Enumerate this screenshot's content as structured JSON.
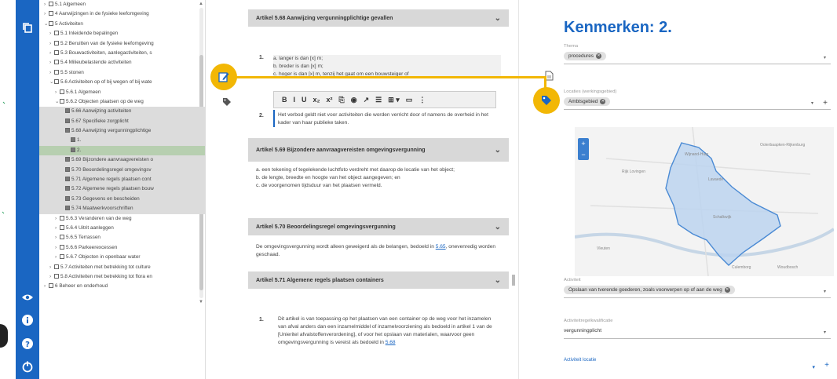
{
  "rail": {
    "icons": [
      "copy-icon",
      "eye-icon",
      "info-icon",
      "help-icon",
      "power-icon"
    ]
  },
  "tree": {
    "rows": [
      {
        "t": "5.1 Algemeen",
        "indent": 0,
        "style": "",
        "kind": "folder"
      },
      {
        "t": "4 Aanwijzingen in de fysieke leefomgeving",
        "indent": 0,
        "style": "",
        "kind": "folder"
      },
      {
        "t": "5 Activiteiten",
        "indent": 0,
        "style": "",
        "kind": "folder-open"
      },
      {
        "t": "5.1 Inleidende bepalingen",
        "indent": 1,
        "style": "",
        "kind": "folder"
      },
      {
        "t": "5.2 Beruitten van de fysieke leefomgeving",
        "indent": 1,
        "style": "",
        "kind": "folder"
      },
      {
        "t": "5.3 Bouwactiviteiten, aanlegactiviteiten, s",
        "indent": 1,
        "style": "",
        "kind": "folder"
      },
      {
        "t": "5.4 Milieubelastende activiteiten",
        "indent": 1,
        "style": "",
        "kind": "folder"
      },
      {
        "t": "5.5 stonen",
        "indent": 1,
        "style": "",
        "kind": "folder"
      },
      {
        "t": "5.6 Activiteiten op of bij wegen of bij wate",
        "indent": 1,
        "style": "",
        "kind": "folder-open"
      },
      {
        "t": "5.6.1 Algemeen",
        "indent": 2,
        "style": "",
        "kind": "folder"
      },
      {
        "t": "5.6.2 Objecten plaatsen op de weg",
        "indent": 2,
        "style": "",
        "kind": "folder-open"
      },
      {
        "t": "5.66 Aanwijzing activiteiten",
        "indent": 3,
        "style": "shade",
        "kind": "check"
      },
      {
        "t": "5.67 Specifieke zorgplicht",
        "indent": 3,
        "style": "shade",
        "kind": "check"
      },
      {
        "t": "5.68 Aanwijzing vergunningplichtige",
        "indent": 3,
        "style": "shade",
        "kind": "check"
      },
      {
        "t": "1.",
        "indent": 4,
        "style": "shade",
        "kind": "check"
      },
      {
        "t": "2.",
        "indent": 4,
        "style": "green",
        "kind": "check"
      },
      {
        "t": "5.69 Bijzondere aanvraagvereisten o",
        "indent": 3,
        "style": "shade",
        "kind": "check"
      },
      {
        "t": "5.70 Beoordelingsregel omgevingsv",
        "indent": 3,
        "style": "shade",
        "kind": "check"
      },
      {
        "t": "5.71 Algemene regels plaatsen cont",
        "indent": 3,
        "style": "shade",
        "kind": "check"
      },
      {
        "t": "5.72 Algemene regels plaatsen bouw",
        "indent": 3,
        "style": "shade",
        "kind": "check"
      },
      {
        "t": "5.73 Gegevens en bescheiden",
        "indent": 3,
        "style": "shade",
        "kind": "check"
      },
      {
        "t": "5.74 Maatwerkvoorschriften",
        "indent": 3,
        "style": "shade",
        "kind": "check"
      },
      {
        "t": "5.6.3 Veranderen van de weg",
        "indent": 2,
        "style": "",
        "kind": "folder"
      },
      {
        "t": "5.6.4 Uitrit aanleggen",
        "indent": 2,
        "style": "",
        "kind": "folder"
      },
      {
        "t": "5.6.5 Terrassen",
        "indent": 2,
        "style": "",
        "kind": "folder"
      },
      {
        "t": "5.6.6 Parkeerexcessen",
        "indent": 2,
        "style": "",
        "kind": "folder"
      },
      {
        "t": "5.6.7 Objecten in openbaar water",
        "indent": 2,
        "style": "",
        "kind": "folder"
      },
      {
        "t": "5.7 Activiteiten met betrekking tot culture",
        "indent": 1,
        "style": "",
        "kind": "folder"
      },
      {
        "t": "5.8 Activiteiten met betrekking tot flora en",
        "indent": 1,
        "style": "",
        "kind": "folder"
      },
      {
        "t": "6 Beheer en onderhoud",
        "indent": 0,
        "style": "",
        "kind": "folder"
      }
    ]
  },
  "doc": {
    "art568": {
      "title": "Artikel  5.68  Aanwijzing vergunningplichtige gevallen"
    },
    "art568_items": [
      "a.  langer is dan [x] m;",
      "b.  breder is dan [x] m;",
      "c.  hoger is dan [x] m, tenzij het gaat om een bouwsteiger of"
    ],
    "art568_num1": "1.",
    "art568_num2": "2.",
    "art568_p2": "Het verbod geldt niet voor activiteiten die worden verricht door of namens de overheid in het kader van haar publieke taken.",
    "toolbar": [
      "B",
      "I",
      "U",
      "x₂",
      "x²",
      "⎘",
      "◉",
      "↗",
      "☰",
      "⊞ ▾",
      "▭",
      "⋮"
    ],
    "art569": {
      "title": "Artikel  5.69  Bijzondere aanvraagvereisten omgevingsvergunning"
    },
    "art569_items": [
      "a.  een tekening of tegelekende luchtfoto verdreht met daarop de locatie van het object;",
      "b.  de lengte, breedte en hoogte van het object aangegeven; en",
      "c.  de voorgenomen tijdsduur van het plaatsen vermeld."
    ],
    "art570": {
      "title": "Artikel  5.70  Beoordelingsregel omgevingsvergunning"
    },
    "art570_p": "De omgevingsvergunning wordt alleen geweigerd als de belangen, bedoeld in",
    "art570_link": "5.65",
    "art570_p_end": ", onevenredig worden geschaad.",
    "art571": {
      "title": "Artikel  5.71  Algemene regels plaatsen containers"
    },
    "art571_num": "1.",
    "art571_p": "Dit artikel is van toepassing op het plaatsen van een container op de weg voor het inzamelen van afval anders dan een inzamelmiddel of inzamelvoorziening als bedoeld in artikel 1 van de [Unieritel afvalstoffenverordening], of voor het opslaan van materialen, waarvoor geen omgevingsvergunning is vereist als bedoeld in",
    "art571_link": "5.68"
  },
  "side": {
    "title": "Kenmerken: 2.",
    "thema_label": "Thema",
    "thema_chip": "procedures",
    "locatie_label": "Locaties (werkingsgebied)",
    "locatie_chip": "Ambtsgebied",
    "map_towns": [
      "Ooterbaapken-Rijkenburg",
      "Wijnand-Huig",
      "Rijk Lovingen",
      "Lavaede",
      "Schalkwijk",
      "Vleuten",
      "Culemborg",
      "Woudbosch"
    ],
    "activiteit_label": "Activiteit",
    "activiteit_chip": "Opslaan van tverende goederen, zoals voorwerpen op of aan de weg",
    "activiteit_kwal_label": "Activiteitregelkwalificatie",
    "activiteit_kwal_value": "vergunningplicht",
    "activiteit_locatie": "Activiteit locatie"
  }
}
